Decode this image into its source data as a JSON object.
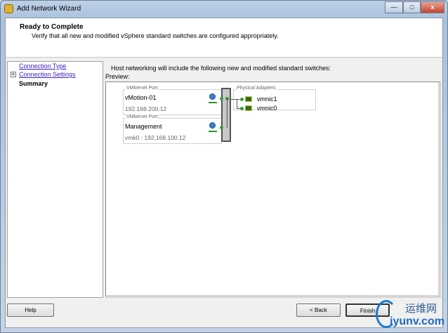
{
  "window": {
    "title": "Add Network Wizard",
    "minimize": "—",
    "maximize": "□",
    "close": "x"
  },
  "header": {
    "title": "Ready to Complete",
    "subtitle": "Verify that all new and modified vSphere standard switches are configured appropriately."
  },
  "nav": {
    "items": [
      {
        "label": "Connection Type"
      },
      {
        "label": "Connection Settings",
        "expander": "+"
      },
      {
        "label": "Summary"
      }
    ]
  },
  "main": {
    "description": "Host networking will include the following new and modified standard switches:",
    "preview_label": "Preview:"
  },
  "preview": {
    "ports": [
      {
        "group_label": "VMkernel Port",
        "name": "vMotion-01",
        "detail": "192.168.200.12"
      },
      {
        "group_label": "VMkernel Port",
        "name": "Management",
        "detail": "vmk0 : 192.168.100.12"
      }
    ],
    "adapters": {
      "group_label": "Physical Adapters",
      "items": [
        "vmnic1",
        "vmnic0"
      ]
    }
  },
  "buttons": {
    "help": "Help",
    "back": "< Back",
    "finish": "Finish"
  },
  "watermark": {
    "text1": "运维网",
    "text2": "iyunv.com"
  }
}
